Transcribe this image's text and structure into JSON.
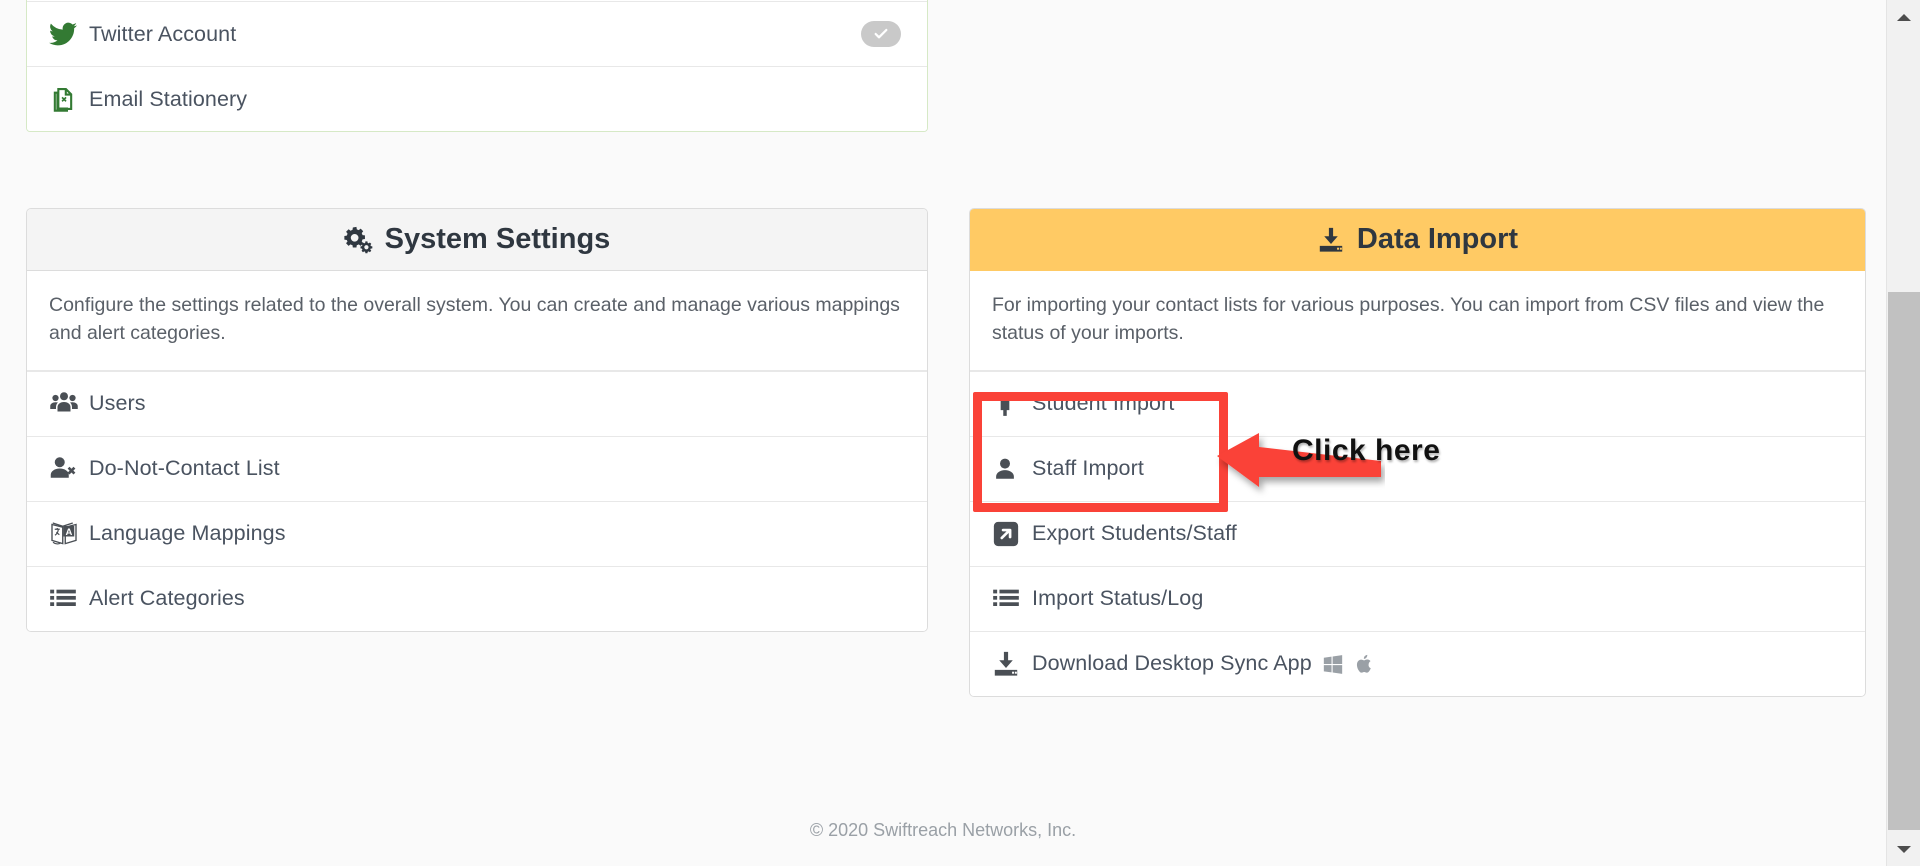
{
  "colors": {
    "amber_header": "#FFCA64",
    "highlight_red": "#FA4238",
    "social_icon_green": "#337A33",
    "icon_grey": "#4A4F55",
    "page_bg": "#FAFAFA"
  },
  "social_panel": {
    "name": "social-accounts-panel",
    "rows": [
      {
        "icon": "twitter-icon",
        "label": "Twitter Account",
        "badge": "check-badge"
      },
      {
        "icon": "email-stationery-icon",
        "label": "Email Stationery",
        "badge": null
      }
    ]
  },
  "system_settings": {
    "header_icon": "cogs-icon",
    "title": "System Settings",
    "description": "Configure the settings related to the overall system. You can create and manage various mappings and alert categories.",
    "items": [
      {
        "icon": "users-icon",
        "label": "Users"
      },
      {
        "icon": "user-times-icon",
        "label": "Do-Not-Contact List"
      },
      {
        "icon": "language-mappings-icon",
        "label": "Language Mappings"
      },
      {
        "icon": "list-icon",
        "label": "Alert Categories"
      }
    ]
  },
  "data_import": {
    "header_icon": "download-inbox-icon",
    "title": "Data Import",
    "description": "For importing your contact lists for various purposes. You can import from CSV files and view the status of your imports.",
    "items": [
      {
        "icon": "student-icon",
        "label": "Student Import",
        "platform_icons": []
      },
      {
        "icon": "staff-user-icon",
        "label": "Staff Import",
        "platform_icons": []
      },
      {
        "icon": "export-arrow-icon",
        "label": "Export Students/Staff",
        "platform_icons": []
      },
      {
        "icon": "list-icon",
        "label": "Import Status/Log",
        "platform_icons": []
      },
      {
        "icon": "download-inbox-icon",
        "label": "Download Desktop Sync App",
        "platform_icons": [
          "windows-icon",
          "apple-icon"
        ]
      }
    ]
  },
  "annotation": {
    "label": "Click here",
    "arrow": "left-arrow-annotation",
    "box": "red-highlight-box"
  },
  "footer": {
    "copyright": "© 2020 Swiftreach Networks, Inc."
  },
  "scrollbar": {
    "up_arrow": "scroll-up-arrow",
    "down_arrow": "scroll-down-arrow",
    "thumb": "scroll-thumb"
  }
}
